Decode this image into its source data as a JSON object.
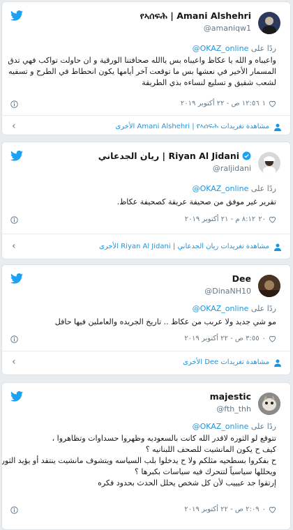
{
  "tweets": [
    {
      "name": "የኣሰፍሕ | Amani Alshehri",
      "handle": "@amaniqw1",
      "reply_prefix": "ردًا على",
      "reply_handle": "@OKAZ_online",
      "text_lines": [
        "واعيباه و الله يا عكاظ واعيباه بس ياالله صحافتنا الورقية و ان حاولت تواكب فهي تدق",
        "المسمار الأخير في نعشها بس ما توقعت آخر أيامها يكون انحطاط في الطرح و تسفيه",
        "لشعب شقيق و تسليع لنساءه بذي الطريقة"
      ],
      "likes": "١",
      "time": "١٢:٥٦ ص - ٢٢ أكتوبر ٢٠١٩",
      "footer": "مشاهدة تغريدات Amani Alshehri | የኣሰፍሕ الأخرى",
      "avatar_color": "#2b3a5c"
    },
    {
      "name": "ريان الجدعاني | Riyan Al Jidani",
      "handle": "@raljidani",
      "reply_prefix": "ردًا على",
      "reply_handle": "@OKAZ_online",
      "text_lines": [
        "تقرير غير موفق من صحيفة عريقة كصحيفة عكاظ."
      ],
      "likes": "٢٠",
      "time": "٨:١٢ م - ٢١ أكتوبر ٢٠١٩",
      "footer": "مشاهدة تغريدات ريان الجدعاني | Riyan Al Jidani الأخرى",
      "avatar_color": "#d8d8d8"
    },
    {
      "name": "Dee",
      "handle": "@DinaNH10",
      "reply_prefix": "ردًا على",
      "reply_handle": "@OKAZ_online",
      "text_lines": [
        "مو شي جديد ولا عربب من عكاظ .. تاريخ الجريده والعاملين فيها حافل"
      ],
      "likes": "٠",
      "time": "٣:٥٥ ص - ٢٢ أكتوبر ٢٠١٩",
      "footer": "مشاهدة تغريدات Dee الأخرى",
      "avatar_color": "#3a2a1c"
    },
    {
      "name": "majestic",
      "handle": "@fth_thh",
      "reply_prefix": "ردًا على",
      "reply_handle": "@OKAZ_online",
      "text_lines": [
        "تتوقع لو الثوره لاقدر الله كانت بالسعوديه وظهروا حسداوات وتظاهروا ،",
        "كيف ح يكون المانشيت للصحف اللبنانيه ؟",
        "ح بفكروا بسطحيه مثلكم ولا ح يدخلوا بلب السياسه ويتشوف مانشيت ينتقد أو يؤيد الثوره",
        "ويحللها سياسياً لتتحرك فيه سياسات بكبرها ؟",
        "إرتقوا جد عيييب لأن كل شخص يحلل الحدث بحدود فكره"
      ],
      "likes": "٠",
      "time": "٢:٠٩ ص - ٢٢ أكتوبر ٢٠١٩",
      "footer": "",
      "avatar_color": "#6b6b6b"
    }
  ],
  "colors": {
    "twitter_blue": "#1da1f2",
    "link_blue": "#1b95e0",
    "muted": "#657786"
  },
  "icons": [
    "twitter-bird-icon",
    "verified-badge-icon",
    "heart-icon",
    "info-icon",
    "person-icon",
    "chevron-left-icon"
  ]
}
